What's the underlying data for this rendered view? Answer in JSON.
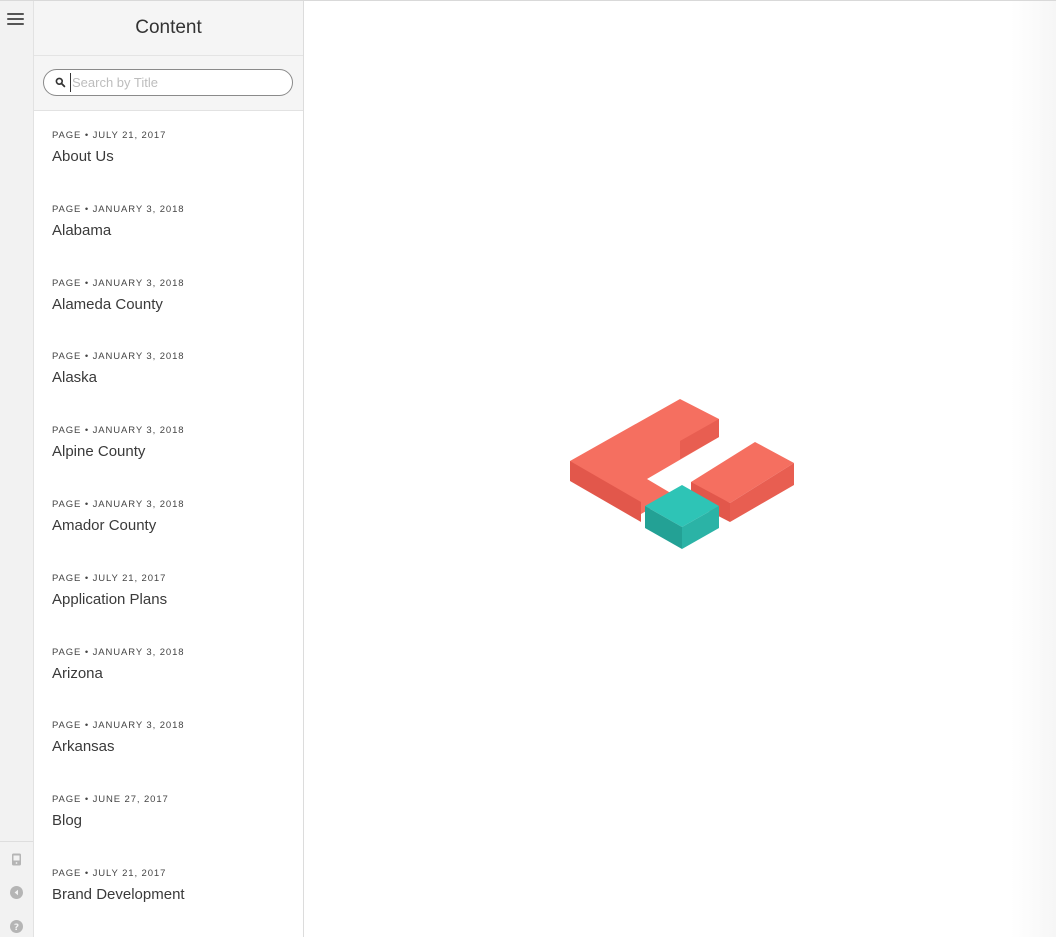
{
  "panel": {
    "title": "Content"
  },
  "search": {
    "placeholder": "Search by Title",
    "value": ""
  },
  "items": [
    {
      "meta": "PAGE • JULY 21, 2017",
      "title": "About Us"
    },
    {
      "meta": "PAGE • JANUARY 3, 2018",
      "title": "Alabama"
    },
    {
      "meta": "PAGE • JANUARY 3, 2018",
      "title": "Alameda County"
    },
    {
      "meta": "PAGE • JANUARY 3, 2018",
      "title": "Alaska"
    },
    {
      "meta": "PAGE • JANUARY 3, 2018",
      "title": "Alpine County"
    },
    {
      "meta": "PAGE • JANUARY 3, 2018",
      "title": "Amador County"
    },
    {
      "meta": "PAGE • JULY 21, 2017",
      "title": "Application Plans"
    },
    {
      "meta": "PAGE • JANUARY 3, 2018",
      "title": "Arizona"
    },
    {
      "meta": "PAGE • JANUARY 3, 2018",
      "title": "Arkansas"
    },
    {
      "meta": "PAGE • JUNE 27, 2017",
      "title": "Blog"
    },
    {
      "meta": "PAGE • JULY 21, 2017",
      "title": "Brand Development"
    }
  ],
  "rail": {
    "top_icon": "hamburger-menu-icon",
    "bottom_icons": [
      "device-preview-icon",
      "collapse-arrow-icon",
      "help-icon"
    ]
  },
  "colors": {
    "logo_coral": "#f56f60",
    "logo_coral_dark": "#e2574b",
    "logo_teal": "#2ec4b6",
    "logo_teal_dark": "#23a195"
  }
}
